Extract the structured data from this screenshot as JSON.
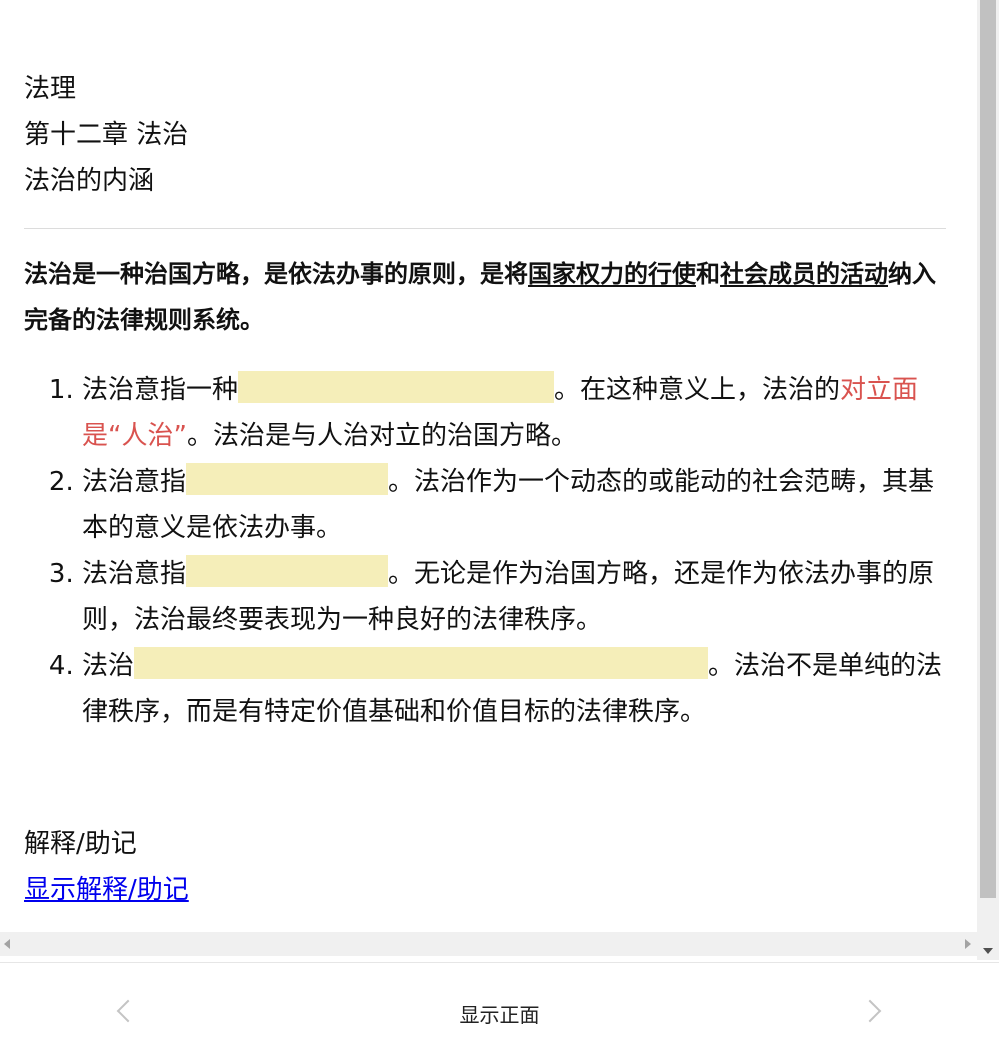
{
  "card": {
    "deck": "法理",
    "chapter": "第十二章 法治",
    "section": "法治的内涵",
    "lead": {
      "part1": "法治是一种治国方略，是依法办事的原则，是将",
      "u1": "国家权力的行使",
      "part2": "和",
      "u2": "社会成员的活动",
      "part3": "纳入完备的法律规则系统。"
    },
    "points": [
      {
        "prefix": "法治意指一种",
        "suffix": "。在这种意义上，法治的",
        "red": "对立面是“人治”",
        "tail": "。法治是与人治对立的治国方略。"
      },
      {
        "prefix": "法治意指",
        "suffix": "。法治作为一个动态的或能动的社会范畴，其基本的意义是依法办事。"
      },
      {
        "prefix": "法治意指",
        "suffix": "。无论是作为治国方略，还是作为依法办事的原则，法治最终要表现为一种良好的法律秩序。"
      },
      {
        "prefix": "法治",
        "suffix": "。法治不是单纯的法律秩序，而是有特定价值基础和价值目标的法律秩序。"
      }
    ],
    "extra_label": "解释/助记",
    "extra_link": "显示解释/助记"
  },
  "bottom_bar": {
    "show_front": "显示正面",
    "prev_icon": "chevron-left-icon",
    "next_icon": "chevron-right-icon"
  },
  "colors": {
    "cloze_highlight": "#f5eeb9",
    "accent_red": "#d9534f",
    "link": "#0000ee"
  }
}
